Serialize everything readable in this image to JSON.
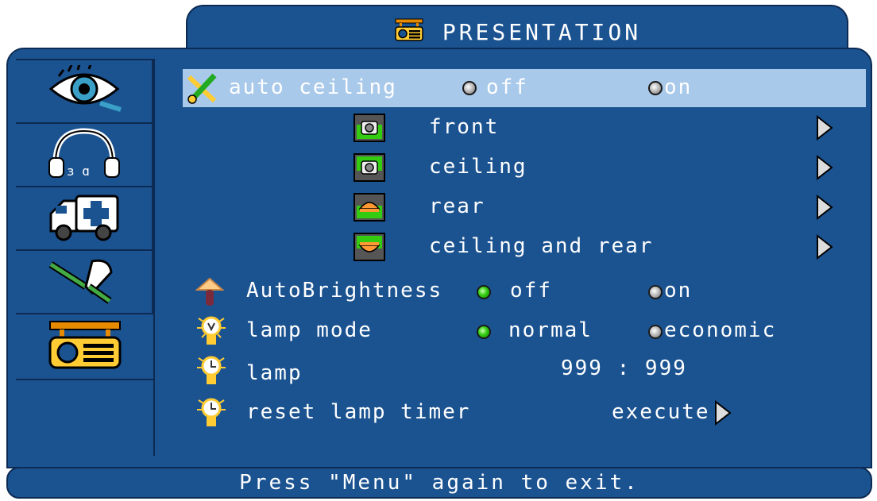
{
  "header": {
    "title": "PRESENTATION",
    "icon": "projector-icon"
  },
  "sidebar": {
    "tabs": [
      {
        "icon": "eye-icon",
        "active": false
      },
      {
        "icon": "headphones-icon",
        "active": false
      },
      {
        "icon": "ambulance-icon",
        "active": false
      },
      {
        "icon": "tools-icon",
        "active": false
      },
      {
        "icon": "projector-icon",
        "active": true
      }
    ]
  },
  "menu": {
    "auto_ceiling": {
      "label": "auto ceiling",
      "opt_off": "off",
      "opt_on": "on",
      "selected": "off"
    },
    "mount_options": [
      {
        "label": "front",
        "icon": "front-mount-icon"
      },
      {
        "label": "ceiling",
        "icon": "ceiling-mount-icon"
      },
      {
        "label": "rear",
        "icon": "rear-mount-icon"
      },
      {
        "label": "ceiling and rear",
        "icon": "ceiling-rear-mount-icon"
      }
    ],
    "auto_brightness": {
      "label": "AutoBrightness",
      "opt_off": "off",
      "opt_on": "on",
      "selected": "off"
    },
    "lamp_mode": {
      "label": "lamp mode",
      "opt_normal": "normal",
      "opt_economic": "economic",
      "selected": "normal"
    },
    "lamp": {
      "label": "lamp",
      "value": "999 : 999"
    },
    "reset_lamp_timer": {
      "label": "reset lamp timer",
      "action": "execute"
    }
  },
  "status": {
    "text": "Press \"Menu\" again to exit."
  },
  "colors": {
    "panel": "#1b5391",
    "border": "#0c2a52",
    "highlight": "#a9c9ea",
    "radio_on": "#33cc11"
  }
}
